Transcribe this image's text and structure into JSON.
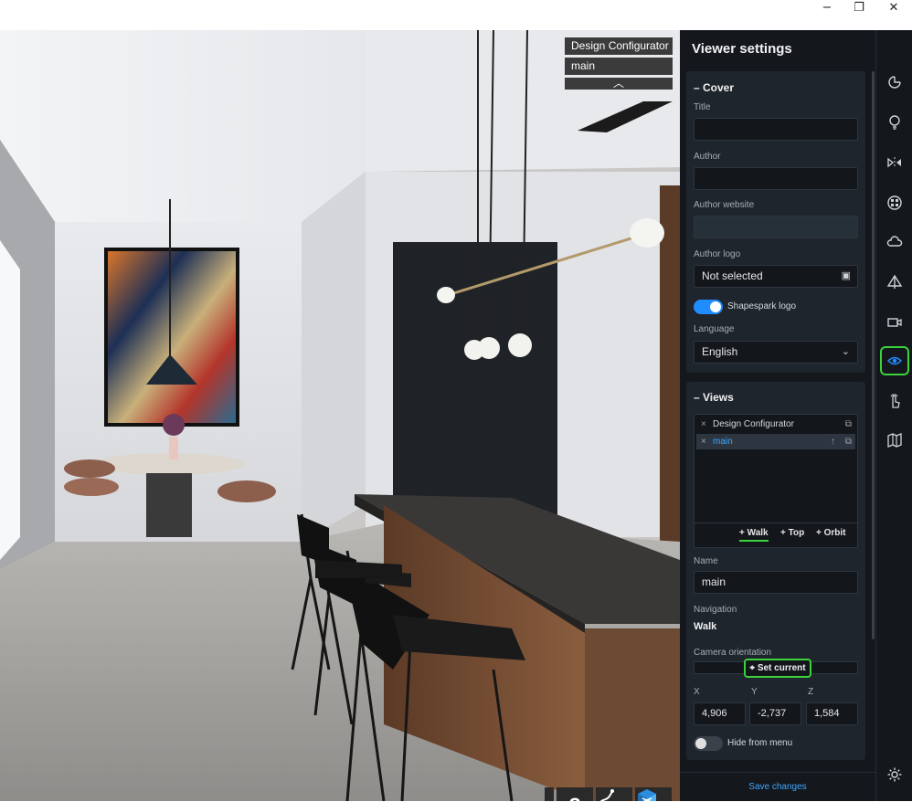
{
  "window": {
    "minimize": "−",
    "restore": "❐",
    "close": "✕"
  },
  "viewer_menu": {
    "item1": "Design Configurator",
    "item2": "main",
    "collapse": "︿"
  },
  "bottom_bar": {
    "expand": "⟩",
    "help": "?",
    "path": "path-icon",
    "logo": "shapespark-logo"
  },
  "panel": {
    "title": "Viewer settings",
    "cover": {
      "header": "Cover",
      "title_label": "Title",
      "title_value": "",
      "author_label": "Author",
      "author_value": "",
      "author_website_label": "Author website",
      "author_website_value": "",
      "author_logo_label": "Author logo",
      "author_logo_value": "Not selected",
      "shapespark_logo_label": "Shapespark logo",
      "shapespark_logo_on": true,
      "language_label": "Language",
      "language_value": "English"
    },
    "views": {
      "header": "Views",
      "items": [
        {
          "label": "Design Configurator",
          "selected": false
        },
        {
          "label": "main",
          "selected": true
        }
      ],
      "add_walk": "Walk",
      "add_top": "Top",
      "add_orbit": "Orbit",
      "name_label": "Name",
      "name_value": "main",
      "navigation_label": "Navigation",
      "navigation_value": "Walk",
      "camera_orientation_label": "Camera orientation",
      "set_current": "Set current",
      "x_label": "X",
      "x_value": "4,906",
      "y_label": "Y",
      "y_value": "-2,737",
      "z_label": "Z",
      "z_value": "1,584",
      "hide_from_menu_label": "Hide from menu",
      "hide_from_menu_on": false
    },
    "save_changes": "Save changes"
  },
  "icon_bar": [
    "materials-icon",
    "light-icon",
    "mirror-icon",
    "texture-icon",
    "cloud-icon",
    "perspective-icon",
    "camera-icon",
    "eye-icon",
    "hand-icon",
    "map-icon",
    "settings-icon"
  ],
  "colors": {
    "accent_green": "#3bd23b",
    "accent_blue": "#1f8cff",
    "link_blue": "#3ea5ff"
  }
}
